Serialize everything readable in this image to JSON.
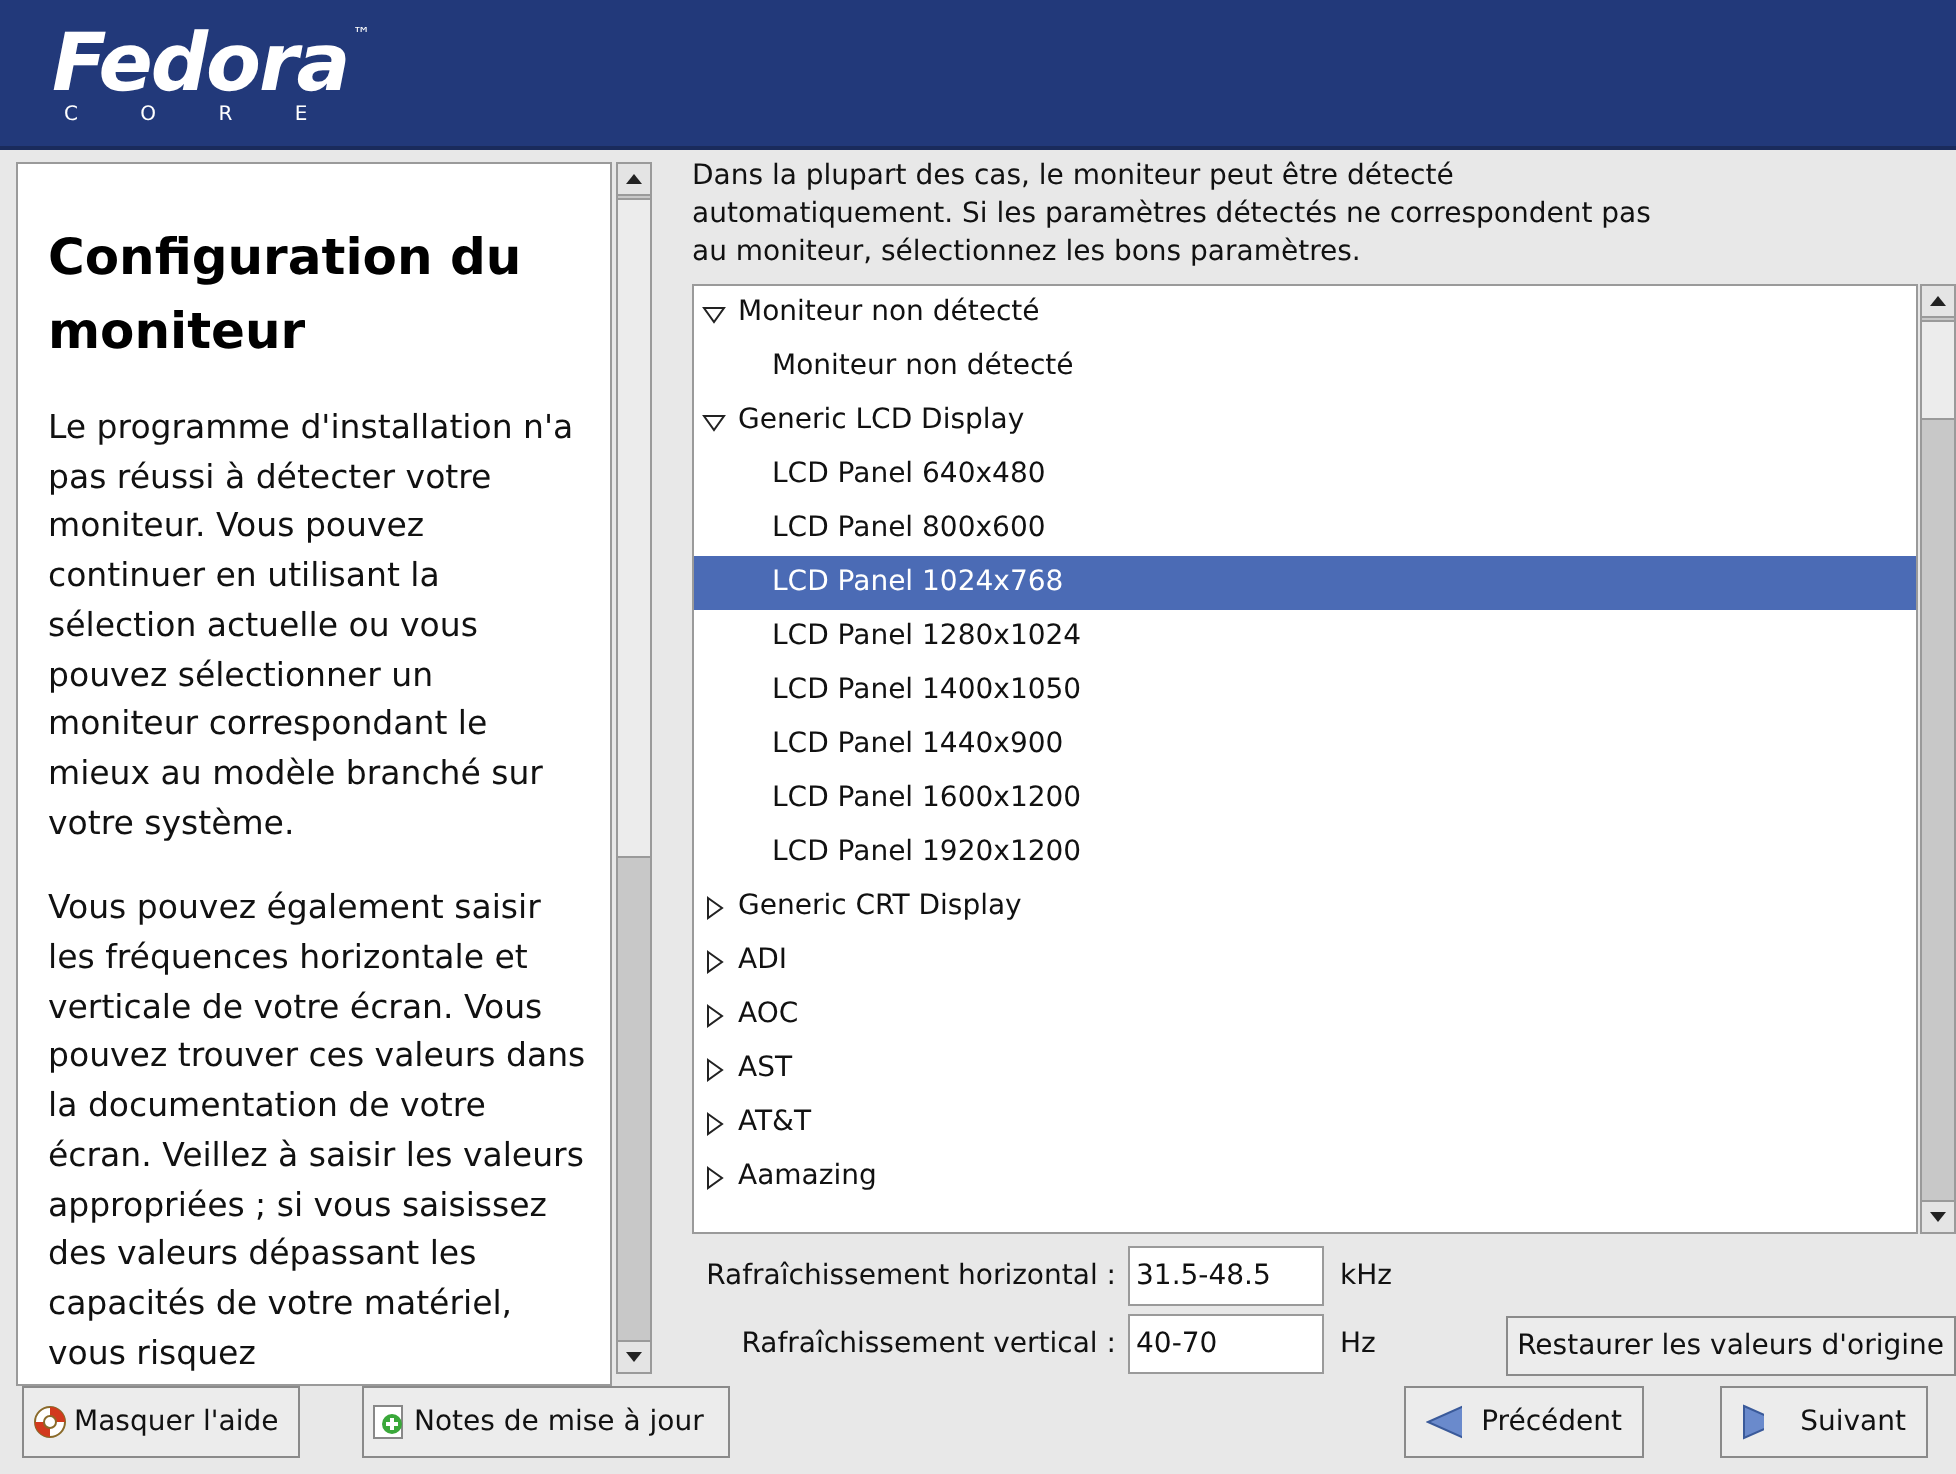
{
  "header": {
    "logo": "Fedora",
    "logo_sub": "C O R E",
    "trademark": "™"
  },
  "help": {
    "title": "Configuration du moniteur",
    "paragraphs": [
      "Le programme d'installation n'a pas réussi à détecter votre moniteur. Vous pouvez continuer en utilisant la sélection actuelle ou vous pouvez sélectionner un moniteur correspondant le mieux au modèle branché sur votre système.",
      "Vous pouvez également saisir les fréquences horizontale et verticale de votre écran. Vous pouvez trouver ces valeurs dans la documentation de votre écran. Veillez à saisir les valeurs appropriées ; si vous saisissez des valeurs dépassant les capacités de votre matériel, vous risquez"
    ]
  },
  "intro": "Dans la plupart des cas, le moniteur peut être détecté automatiquement. Si les paramètres détectés ne correspondent pas au moniteur, sélectionnez les bons paramètres.",
  "tree": [
    {
      "label": "Moniteur non détecté",
      "expanded": true,
      "selected": false,
      "children": [
        {
          "label": "Moniteur non détecté",
          "selected": false
        }
      ]
    },
    {
      "label": "Generic LCD Display",
      "expanded": true,
      "selected": false,
      "children": [
        {
          "label": "LCD Panel 640x480",
          "selected": false
        },
        {
          "label": "LCD Panel 800x600",
          "selected": false
        },
        {
          "label": "LCD Panel 1024x768",
          "selected": true
        },
        {
          "label": "LCD Panel 1280x1024",
          "selected": false
        },
        {
          "label": "LCD Panel 1400x1050",
          "selected": false
        },
        {
          "label": "LCD Panel 1440x900",
          "selected": false
        },
        {
          "label": "LCD Panel 1600x1200",
          "selected": false
        },
        {
          "label": "LCD Panel 1920x1200",
          "selected": false
        }
      ]
    },
    {
      "label": "Generic CRT Display",
      "expanded": false,
      "selected": false
    },
    {
      "label": "ADI",
      "expanded": false,
      "selected": false
    },
    {
      "label": "AOC",
      "expanded": false,
      "selected": false
    },
    {
      "label": "AST",
      "expanded": false,
      "selected": false
    },
    {
      "label": "AT&T",
      "expanded": false,
      "selected": false
    },
    {
      "label": "Aamazing",
      "expanded": false,
      "selected": false
    }
  ],
  "fields": [
    {
      "label": "Rafraîchissement horizontal :",
      "value": "31.5-48.5",
      "unit": "kHz"
    },
    {
      "label": "Rafraîchissement vertical :",
      "value": "40-70",
      "unit": "Hz"
    }
  ],
  "restore_button": "Restaurer les valeurs d'origine",
  "buttons": [
    {
      "kind": "help",
      "label": "Masquer l'aide"
    },
    {
      "kind": "notes",
      "label": "Notes de mise à jour"
    },
    {
      "kind": "back",
      "label": "Précédent"
    },
    {
      "kind": "next",
      "label": "Suivant"
    }
  ]
}
